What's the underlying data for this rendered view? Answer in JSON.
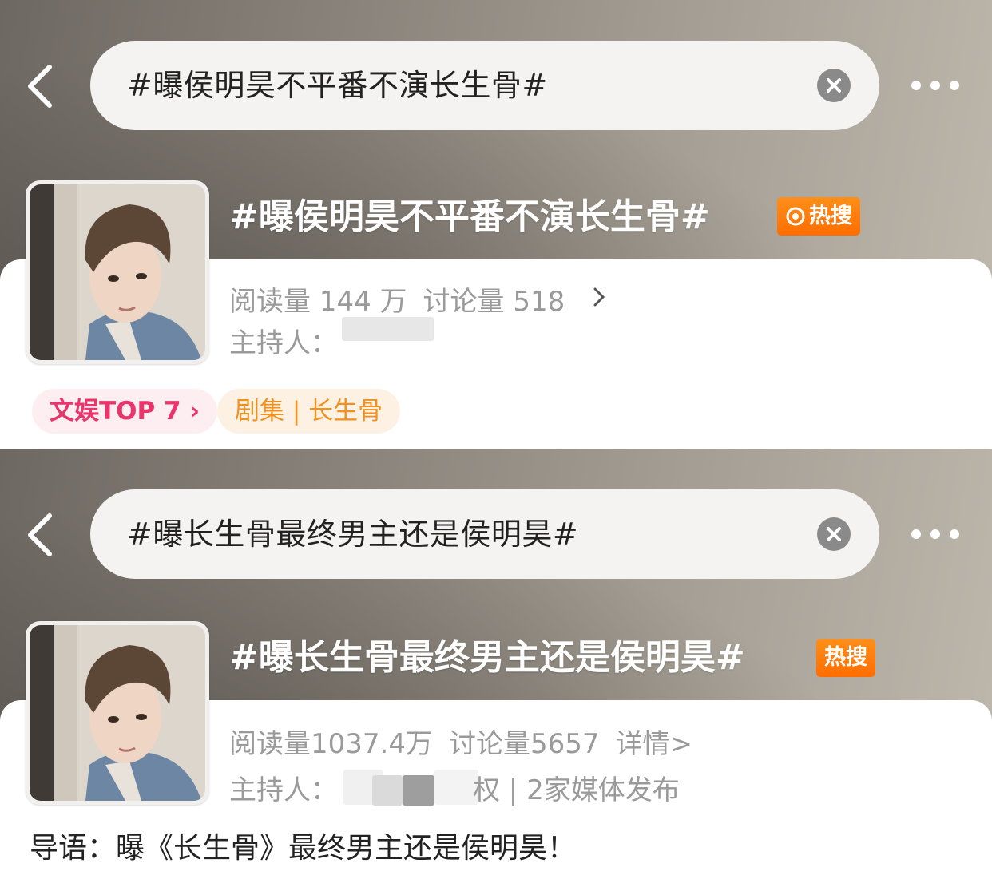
{
  "panels": [
    {
      "search_query": "#曝侯明昊不平番不演长生骨#",
      "topic_title": "#曝侯明昊不平番不演长生骨#",
      "hot_badge": "热搜",
      "reads": "阅读量 144 万",
      "discussions": "讨论量 518",
      "details": "",
      "host_label": "主持人：",
      "host_suffix": "",
      "tags": {
        "rank": "文娱TOP 7 ›",
        "category": "剧集 | 长生骨"
      }
    },
    {
      "search_query": "#曝长生骨最终男主还是侯明昊#",
      "topic_title": "#曝长生骨最终男主还是侯明昊#",
      "hot_badge": "热搜",
      "reads": "阅读量1037.4万",
      "discussions": "讨论量5657",
      "details": "详情>",
      "host_label": "主持人：",
      "host_suffix": "权 | 2家媒体发布",
      "intro": "导语：曝《长生骨》最终男主还是侯明昊！"
    }
  ],
  "colors": {
    "hot_badge": "#ff7a00",
    "rank_tag_text": "#e9356b",
    "category_tag_text": "#f0901f"
  },
  "icons": [
    "chevron-left-icon",
    "clear-icon",
    "more-dots-icon",
    "flame-icon",
    "chevron-right-icon"
  ]
}
